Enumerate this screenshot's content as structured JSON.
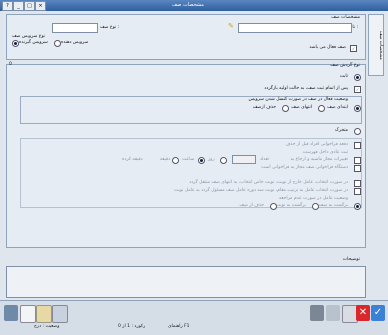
{
  "window": {
    "title": "مشخصات صف",
    "btn_help": "?",
    "btn_min": "_",
    "btn_max": "□",
    "btn_close": "×"
  },
  "side_tab": "مشخصات صف",
  "sec1": {
    "title": "مشخصات صف",
    "queue_name_label": "نام صف :",
    "queue_name_value": "",
    "queue_type_label": "نوع صف :",
    "queue_type_value": "",
    "service_type_legend": "نوع سرویس صف",
    "radio_recv": "سرویس گیرنده",
    "radio_prov": "سرویس دهنده",
    "active_label": "صف فعال می باشد"
  },
  "sec2": {
    "title": "نوع گردش صف",
    "section_marker": "0",
    "option_static": "ثابت",
    "static_check1": "پس از اتمام ثبت صف، به حالت اولیه بازگردد",
    "static_group": "وضعیت فعال در صف در صورت کنسل شدن سرویس",
    "static_r1": "ابتدای صف",
    "static_r2": "انتهای صف",
    "static_r3": "حذف ازصف",
    "option_dynamic": "متحرک",
    "dyn_line1": "دفعه فراخوانی افراد قبل از حذف",
    "dyn_group": "ثبت عادی داخل فهرست",
    "dyn_line2": "تغییرات مجاز ماسبه و ارجاع به",
    "dyn_count_label": "تعداد",
    "dyn_count_value": "",
    "dyn_unit_day": "روز",
    "dyn_unit_hour": "ساعت",
    "dyn_unit_min": "دقیقه",
    "dyn_time_label": "دقیقه کرده",
    "dyn_line3": "دستگاه فراخوانی صف مجاز به فراخوانی است",
    "dyn_line4": "در صورت انتخاب، عامل خارج از نوبت، نوبت خاص انتخاب، به انتهای صف منتقل گردد",
    "dyn_line5": "در صورت انتخاب عامل به ترتیب مقام، نوبت سه دوره عامل صف مسئول گردد به عامل نوبت",
    "dyn_group2": "وضعیت عامل در صورت عدم مراجعه",
    "dyn_r1": "برگشت به صف",
    "dyn_r2": "برگشت به نوبت",
    "dyn_r3": "حذف از صف"
  },
  "sec3": {
    "title": "توضیحات",
    "value": ""
  },
  "status": {
    "left": "وضعیت : درج",
    "middle": "رکورد : 1 از 0",
    "right": "راهنمای F1"
  },
  "colors": {
    "title_bg": "#2f5f9e",
    "panel_bg": "#e6ecf3",
    "accent_check": "#2a7a2a"
  }
}
